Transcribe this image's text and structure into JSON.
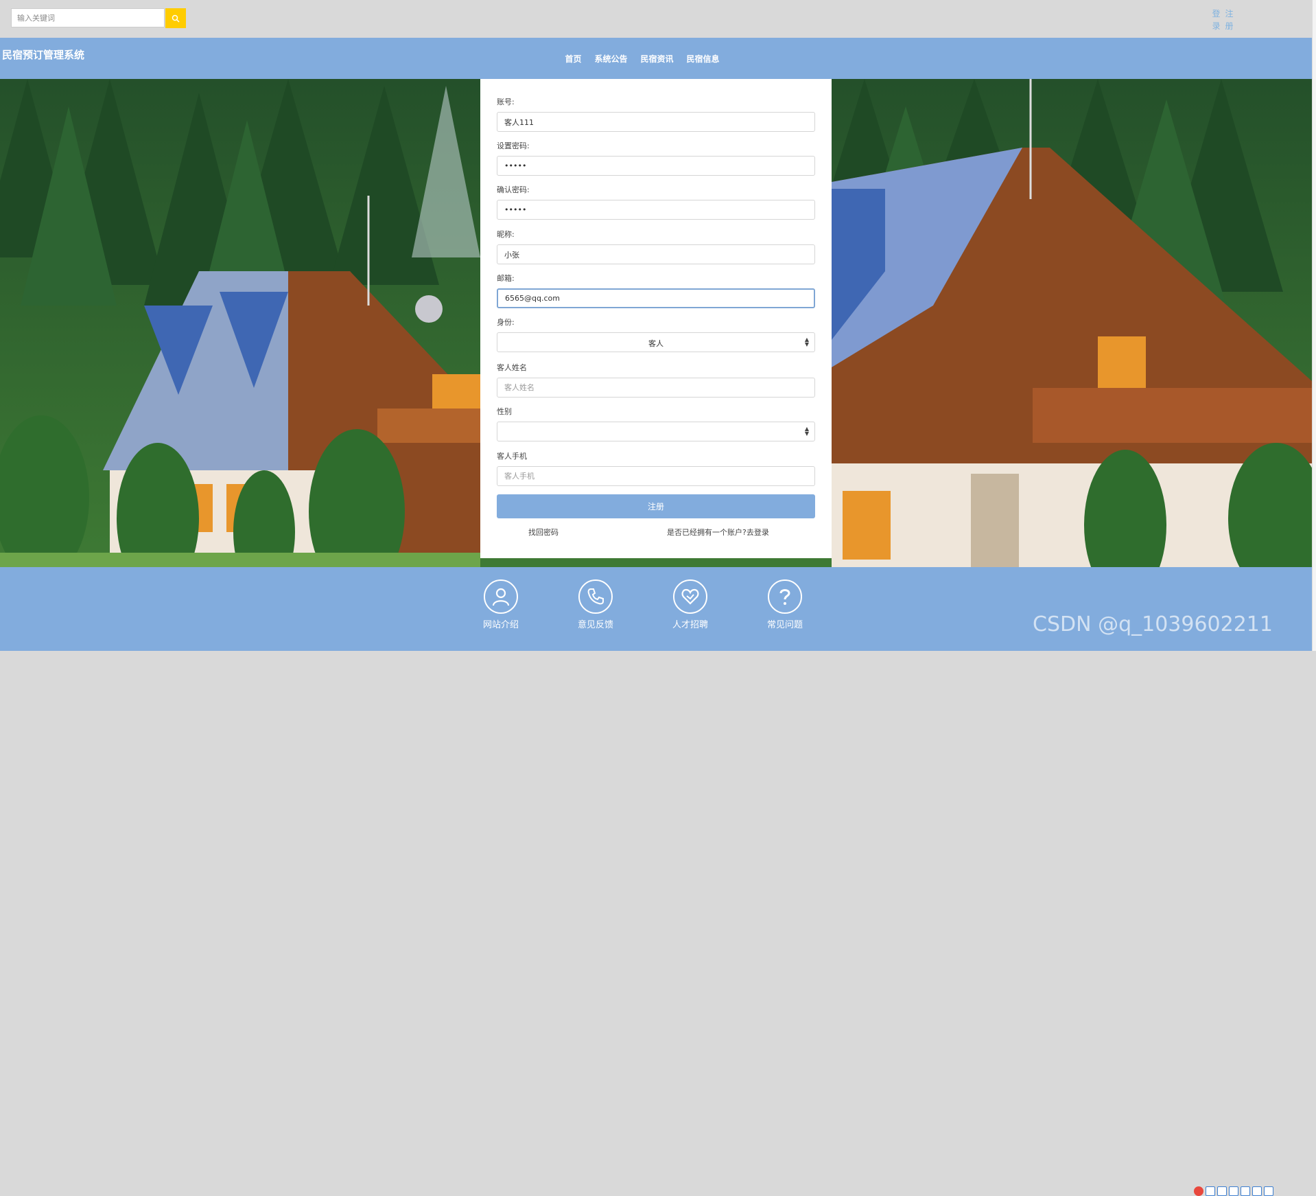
{
  "topbar": {
    "search_placeholder": "输入关键词",
    "login_label": "登录",
    "register_label": "注册"
  },
  "header": {
    "site_title": "民宿预订管理系统",
    "nav": [
      "首页",
      "系统公告",
      "民宿资讯",
      "民宿信息"
    ]
  },
  "form": {
    "account_label": "账号:",
    "account_value": "客人111",
    "password_label": "设置密码:",
    "password_value": "11111",
    "confirm_label": "确认密码:",
    "confirm_value": "11111",
    "nickname_label": "昵称:",
    "nickname_value": "小张",
    "email_label": "邮箱:",
    "email_value": "6565@qq.com",
    "role_label": "身份:",
    "role_value": "客人",
    "name_label": "客人姓名",
    "name_placeholder": "客人姓名",
    "gender_label": "性别",
    "gender_value": "",
    "phone_label": "客人手机",
    "phone_placeholder": "客人手机",
    "submit_label": "注册",
    "forgot_label": "找回密码",
    "have_account_label": "是否已经拥有一个账户?去登录"
  },
  "footer": {
    "items": [
      {
        "label": "网站介绍",
        "icon": "user-icon"
      },
      {
        "label": "意见反馈",
        "icon": "phone-icon"
      },
      {
        "label": "人才招聘",
        "icon": "heart-icon"
      },
      {
        "label": "常见问题",
        "icon": "question-icon"
      }
    ]
  },
  "watermark": "CSDN @q_1039602211",
  "colors": {
    "header_bg": "#82acdd",
    "search_button": "#ffcc00",
    "topbar_bg": "#d9d9d9"
  }
}
